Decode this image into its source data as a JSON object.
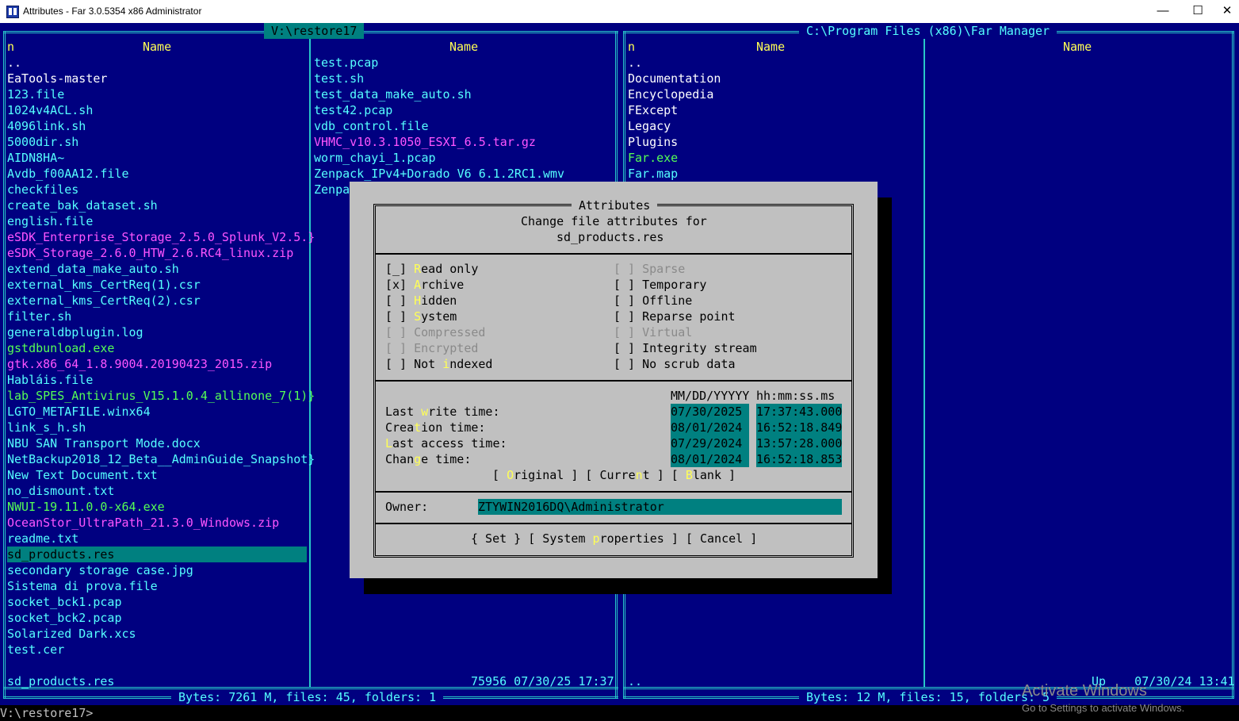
{
  "window": {
    "title": "Attributes - Far 3.0.5354 x86 Administrator",
    "minimize": "—",
    "maximize": "☐",
    "close": "✕"
  },
  "left_panel": {
    "path": " V:\\restore17 ",
    "col1_mode": "n",
    "col1_header": "Name",
    "col2_header": "Name",
    "col1_files": [
      {
        "name": "..",
        "kind": "dir"
      },
      {
        "name": "EaTools-master",
        "kind": "dir"
      },
      {
        "name": "123.file",
        "kind": "file"
      },
      {
        "name": "1024v4ACL.sh",
        "kind": "file"
      },
      {
        "name": "4096link.sh",
        "kind": "file"
      },
      {
        "name": "5000dir.sh",
        "kind": "file"
      },
      {
        "name": "AIDN8HA~",
        "kind": "file"
      },
      {
        "name": "Avdb_f00AA12.file",
        "kind": "file"
      },
      {
        "name": "checkfiles",
        "kind": "file"
      },
      {
        "name": "create_bak_dataset.sh",
        "kind": "file"
      },
      {
        "name": "english.file",
        "kind": "file"
      },
      {
        "name": "eSDK_Enterprise_Storage_2.5.0_Splunk_V2.5.}",
        "kind": "zip"
      },
      {
        "name": "eSDK_Storage_2.6.0_HTW_2.6.RC4_linux.zip",
        "kind": "zip"
      },
      {
        "name": "extend_data_make_auto.sh",
        "kind": "file"
      },
      {
        "name": "external_kms_CertReq(1).csr",
        "kind": "file"
      },
      {
        "name": "external_kms_CertReq(2).csr",
        "kind": "file"
      },
      {
        "name": "filter.sh",
        "kind": "file"
      },
      {
        "name": "generaldbplugin.log",
        "kind": "file"
      },
      {
        "name": "gstdbunload.exe",
        "kind": "exe"
      },
      {
        "name": "gtk.x86_64_1.8.9004.20190423_2015.zip",
        "kind": "zip"
      },
      {
        "name": "Habláis.file",
        "kind": "file"
      },
      {
        "name": "lab_SPES_Antivirus_V15.1.0.4_allinone_7(1)}",
        "kind": "exe"
      },
      {
        "name": "LGTO_METAFILE.winx64",
        "kind": "file"
      },
      {
        "name": "link_s_h.sh",
        "kind": "file"
      },
      {
        "name": "NBU SAN Transport Mode.docx",
        "kind": "file"
      },
      {
        "name": "NetBackup2018_12_Beta__AdminGuide_Snapshot}",
        "kind": "file"
      },
      {
        "name": "New Text Document.txt",
        "kind": "file"
      },
      {
        "name": "no_dismount.txt",
        "kind": "file"
      },
      {
        "name": "NWUI-19.11.0.0-x64.exe",
        "kind": "exe"
      },
      {
        "name": "OceanStor_UltraPath_21.3.0_Windows.zip",
        "kind": "zip"
      },
      {
        "name": "readme.txt",
        "kind": "file"
      },
      {
        "name": "sd_products.res",
        "kind": "selected"
      },
      {
        "name": "secondary storage case.jpg",
        "kind": "file"
      },
      {
        "name": "Sistema di prova.file",
        "kind": "file"
      },
      {
        "name": "socket_bck1.pcap",
        "kind": "file"
      },
      {
        "name": "socket_bck2.pcap",
        "kind": "file"
      },
      {
        "name": "Solarized Dark.xcs",
        "kind": "file"
      },
      {
        "name": "test.cer",
        "kind": "file"
      }
    ],
    "col2_files": [
      {
        "name": "test.pcap",
        "kind": "file"
      },
      {
        "name": "test.sh",
        "kind": "file"
      },
      {
        "name": "test_data_make_auto.sh",
        "kind": "file"
      },
      {
        "name": "test42.pcap",
        "kind": "file"
      },
      {
        "name": "vdb_control.file",
        "kind": "file"
      },
      {
        "name": "VHMC_v10.3.1050_ESXI_6.5.tar.gz",
        "kind": "zip"
      },
      {
        "name": "worm_chayi_1.pcap",
        "kind": "file"
      },
      {
        "name": "Zenpack_IPv4+Dorado V6 6.1.2RC1.wmv",
        "kind": "file"
      },
      {
        "name": "Zenpa",
        "kind": "file"
      }
    ],
    "status_name": "sd_products.res",
    "status_info": "75956 07/30/25 17:37",
    "totals": " Bytes: 7261 M, files: 45, folders: 1 "
  },
  "right_panel": {
    "path": " C:\\Program Files (x86)\\Far Manager ",
    "col1_mode": "n",
    "col1_header": "Name",
    "col2_header": "Name",
    "col1_files": [
      {
        "name": "..",
        "kind": "dir"
      },
      {
        "name": "Documentation",
        "kind": "dir"
      },
      {
        "name": "Encyclopedia",
        "kind": "dir"
      },
      {
        "name": "FExcept",
        "kind": "dir"
      },
      {
        "name": "Legacy",
        "kind": "dir"
      },
      {
        "name": "Plugins",
        "kind": "dir"
      },
      {
        "name": "Far.exe",
        "kind": "exe"
      },
      {
        "name": "Far.map",
        "kind": "file"
      }
    ],
    "status_name": "..",
    "status_info": "Up    07/30/24 13:41",
    "totals": " Bytes: 12 M, files: 15, folders: 5 "
  },
  "cmdline": "V:\\restore17>",
  "watermark": {
    "line1": "Activate Windows",
    "line2": "Go to Settings to activate Windows."
  },
  "dialog": {
    "title": " Attributes ",
    "subtitle1": "Change file attributes for",
    "subtitle2": "sd_products.res",
    "attrs_left": [
      {
        "box": "[_]",
        "pre": "",
        "hot": "R",
        "post": "ead only",
        "state": "normal"
      },
      {
        "box": "[x]",
        "pre": "",
        "hot": "A",
        "post": "rchive",
        "state": "normal"
      },
      {
        "box": "[ ]",
        "pre": "",
        "hot": "H",
        "post": "idden",
        "state": "normal"
      },
      {
        "box": "[ ]",
        "pre": "",
        "hot": "S",
        "post": "ystem",
        "state": "normal"
      },
      {
        "box": "[ ]",
        "pre": "Compressed",
        "hot": "",
        "post": "",
        "state": "disabled"
      },
      {
        "box": "[ ]",
        "pre": "Encrypted",
        "hot": "",
        "post": "",
        "state": "disabled"
      },
      {
        "box": "[ ]",
        "pre": "Not ",
        "hot": "i",
        "post": "ndexed",
        "state": "normal"
      }
    ],
    "attrs_right": [
      {
        "box": "[ ]",
        "pre": "Sparse",
        "hot": "",
        "post": "",
        "state": "disabled"
      },
      {
        "box": "[ ]",
        "pre": "Temporary",
        "hot": "",
        "post": "",
        "state": "normal"
      },
      {
        "box": "[ ]",
        "pre": "Offline",
        "hot": "",
        "post": "",
        "state": "normal"
      },
      {
        "box": "[ ]",
        "pre": "Reparse point",
        "hot": "",
        "post": "",
        "state": "normal"
      },
      {
        "box": "[ ]",
        "pre": "Virtual",
        "hot": "",
        "post": "",
        "state": "disabled"
      },
      {
        "box": "[ ]",
        "pre": "Integrity stream",
        "hot": "",
        "post": "",
        "state": "normal"
      },
      {
        "box": "[ ]",
        "pre": "No scrub data",
        "hot": "",
        "post": "",
        "state": "normal"
      }
    ],
    "date_header": "MM/DD/YYYYY",
    "time_header": "hh:mm:ss.ms",
    "times": [
      {
        "pre": "Last ",
        "hot": "w",
        "post": "rite time:",
        "date": "07/30/2025",
        "time": "17:37:43.000"
      },
      {
        "pre": "Crea",
        "hot": "t",
        "post": "ion time:",
        "date": "08/01/2024",
        "time": "16:52:18.849"
      },
      {
        "pre": "",
        "hot": "L",
        "post": "ast access time:",
        "date": "07/29/2024",
        "time": "13:57:28.000"
      },
      {
        "pre": "Chan",
        "hot": "g",
        "post": "e time:",
        "date": "08/01/2024",
        "time": "16:52:18.853"
      }
    ],
    "buttons_time": [
      {
        "pre": "[ ",
        "hot": "O",
        "post": "riginal ]"
      },
      {
        "pre": "[ Curre",
        "hot": "n",
        "post": "t ]"
      },
      {
        "pre": "[ ",
        "hot": "B",
        "post": "lank ]"
      }
    ],
    "owner_label": "Owner:",
    "owner_value": "ZTYWIN2016DQ\\Administrator",
    "buttons": [
      {
        "pre": "{ Set }",
        "hot": "",
        "post": ""
      },
      {
        "pre": "[ System ",
        "hot": "p",
        "post": "roperties ]"
      },
      {
        "pre": "[ Cancel ]",
        "hot": "",
        "post": ""
      }
    ]
  }
}
